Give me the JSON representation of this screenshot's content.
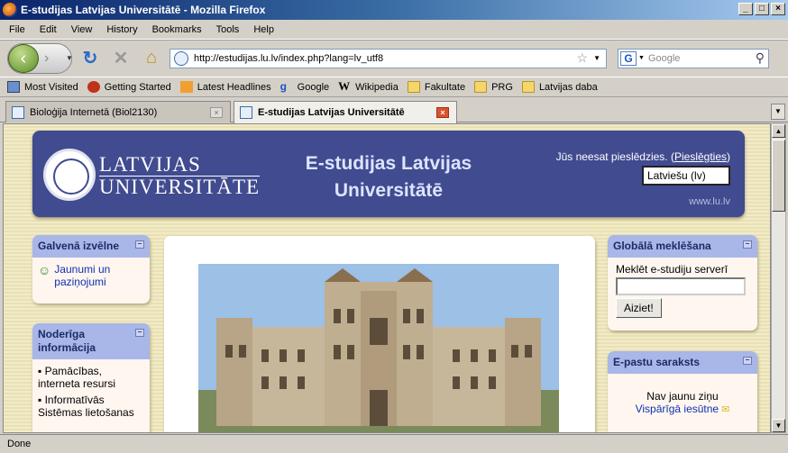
{
  "window": {
    "title": "E-studijas Latvijas Universitātē - Mozilla Firefox"
  },
  "menu": [
    "File",
    "Edit",
    "View",
    "History",
    "Bookmarks",
    "Tools",
    "Help"
  ],
  "toolbar": {
    "url": "http://estudijas.lu.lv/index.php?lang=lv_utf8",
    "search_placeholder": "Google",
    "search_engine": "G"
  },
  "bookmarks": [
    {
      "label": "Most Visited",
      "icon": "most-visited-icon"
    },
    {
      "label": "Getting Started",
      "icon": "firefox-icon"
    },
    {
      "label": "Latest Headlines",
      "icon": "rss-icon"
    },
    {
      "label": "Google",
      "icon": "google-icon"
    },
    {
      "label": "Wikipedia",
      "icon": "wikipedia-icon"
    },
    {
      "label": "Fakultate",
      "icon": "folder-icon"
    },
    {
      "label": "PRG",
      "icon": "folder-icon"
    },
    {
      "label": "Latvijas daba",
      "icon": "folder-icon"
    }
  ],
  "tabs": [
    {
      "label": "Bioloģija Internetā (Biol2130)",
      "active": false
    },
    {
      "label": "E-studijas Latvijas Universitātē",
      "active": true
    }
  ],
  "page": {
    "logo_line1": "LATVIJAS",
    "logo_line2": "UNIVERSITĀTE",
    "site_name_line1": "E-studijas Latvijas",
    "site_name_line2": "Universitātē",
    "login_text": "Jūs neesat pieslēdzies. (",
    "login_link": "Pieslēgties",
    "login_close": ")",
    "language": "Latviešu (lv)",
    "website": "www.lu.lv",
    "main_menu": {
      "title": "Galvenā izvēlne",
      "items": [
        "Jaunumi un paziņojumi"
      ]
    },
    "useful_info": {
      "title": "Noderīga informācija",
      "items": [
        "Pamācības, interneta resursi",
        "Informatīvās Sistēmas lietošanas"
      ]
    },
    "global_search": {
      "title": "Globālā meklēšana",
      "label": "Meklēt e-studiju serverī",
      "button": "Aiziet!"
    },
    "mailing_list": {
      "title": "E-pastu saraksts",
      "no_news": "Nav jaunu ziņu",
      "general_inbox": "Vispārīgā iesūtne"
    }
  },
  "status": {
    "text": "Done"
  },
  "colors": {
    "header_bg": "#414b8f",
    "block_header": "#a9b6e8",
    "page_bg": "#f2ebc8"
  }
}
